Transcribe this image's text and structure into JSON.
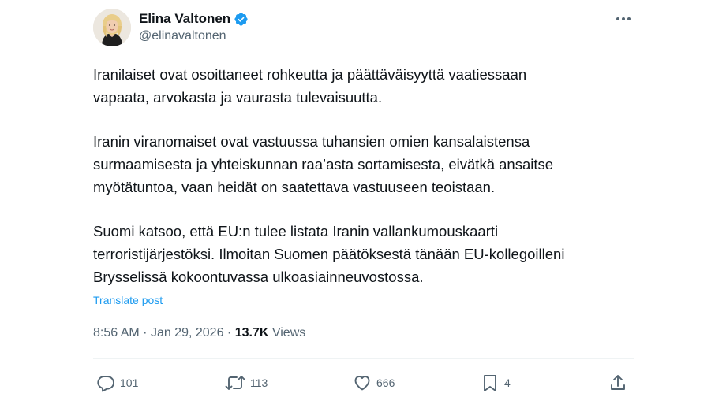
{
  "author": {
    "display_name": "Elina Valtonen",
    "handle": "@elinavaltonen",
    "verified": true,
    "verified_color": "#1d9bf0"
  },
  "tweet": {
    "paragraphs": [
      "Iranilaiset ovat osoittaneet rohkeutta ja päättäväisyyttä vaatiessaan\nvapaata, arvokasta ja vaurasta tulevaisuutta.",
      "Iranin viranomaiset ovat vastuussa tuhansien omien kansalaistensa\nsurmaamisesta ja yhteiskunnan raa’asta sortamisesta, eivätkä ansaitse\nmyötätuntoa, vaan heidät on saatettava vastuuseen teoistaan.",
      "Suomi katsoo, että EU:n tulee listata Iranin vallankumouskaarti\nterroristijärjestöksi. Ilmoitan Suomen päätöksestä tänään EU-kollegoilleni\nBrysselissä kokoontuvassa ulkoasiainneuvostossa."
    ],
    "translate_label": "Translate post",
    "time": "8:56 AM",
    "separator": "·",
    "date": "Jan 29, 2026",
    "views_count": "13.7K",
    "views_label": "Views"
  },
  "actions": {
    "replies": "101",
    "reposts": "113",
    "likes": "666",
    "bookmarks": "4"
  },
  "colors": {
    "text": "#0f1419",
    "secondary": "#536471",
    "link": "#1d9bf0",
    "divider": "#eff3f4"
  },
  "icons": [
    "verified-badge-icon",
    "more-icon",
    "reply-icon",
    "repost-icon",
    "like-icon",
    "bookmark-icon",
    "share-icon"
  ]
}
